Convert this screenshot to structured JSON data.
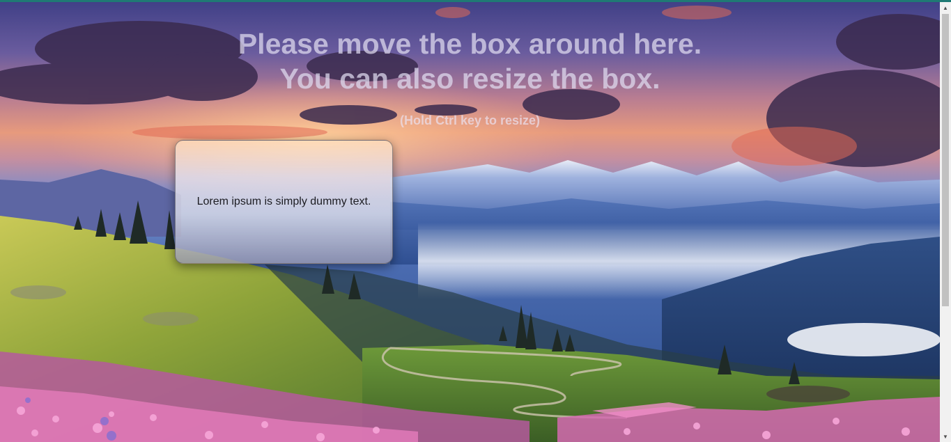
{
  "page": {
    "headline_line1": "Please move the box around here.",
    "headline_line2": "You can also resize the box.",
    "hint": "(Hold Ctrl key to resize)"
  },
  "box": {
    "text": "Lorem ipsum is simply dummy text."
  },
  "colors": {
    "accent_bar": "#1f7a74",
    "headline": "#e1dcf0",
    "box_text": "#1c1c22"
  },
  "scrollbar": {
    "up_icon": "chevron-up-icon",
    "down_icon": "chevron-down-icon"
  }
}
